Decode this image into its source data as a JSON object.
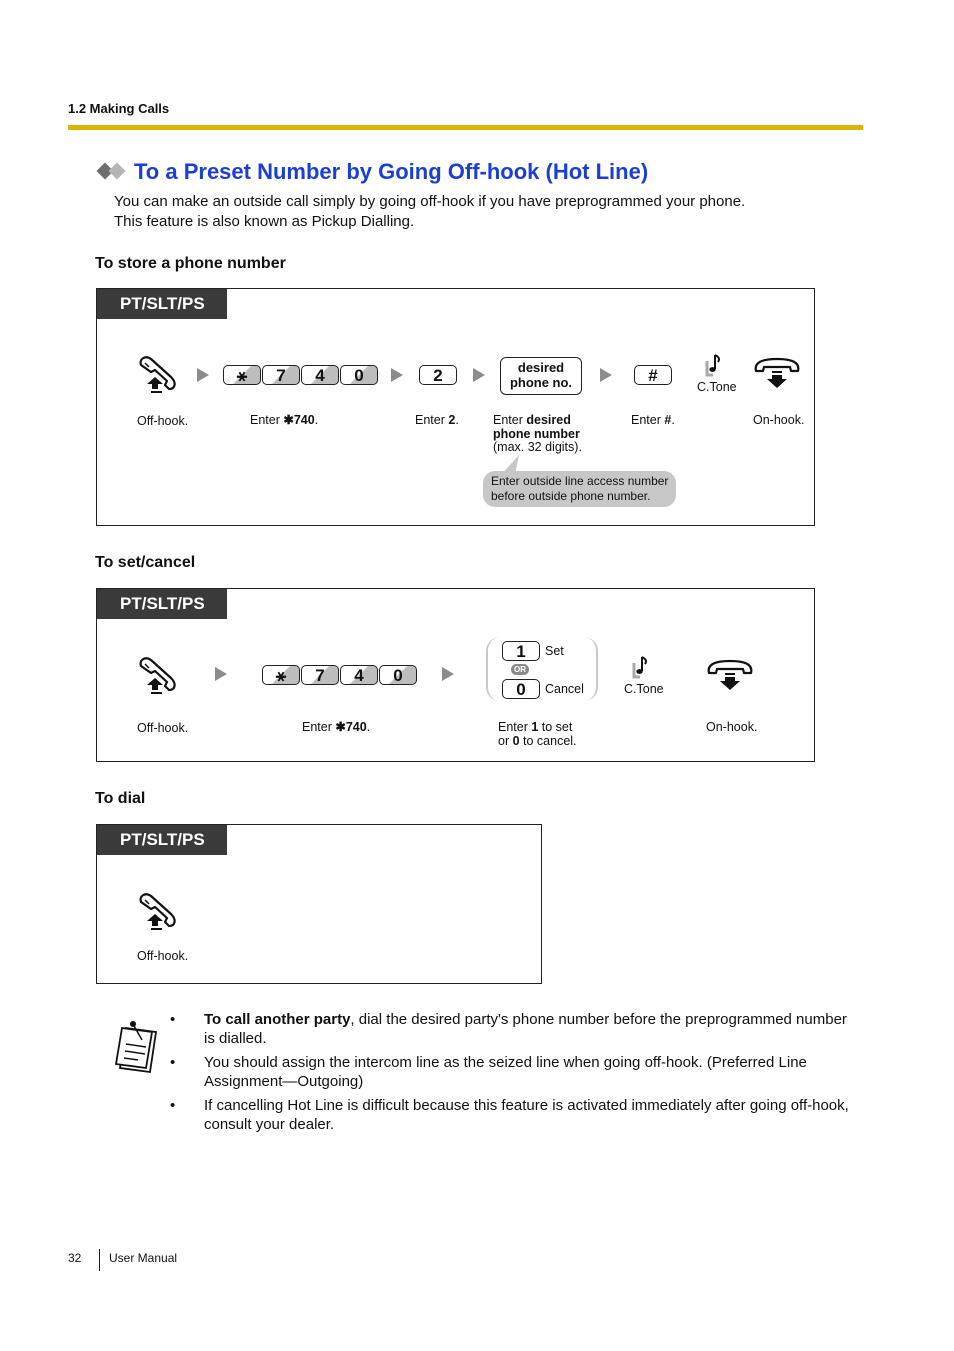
{
  "header": {
    "section": "1.2 Making Calls",
    "accent_color": "#dcb500"
  },
  "title": "To a Preset Number by Going Off-hook (Hot Line)",
  "title_color": "#1b3fd6",
  "intro": [
    "You can make an outside call simply by going off-hook if you have preprogrammed your phone.",
    "This feature is also known as Pickup Dialling."
  ],
  "store": {
    "heading": "To store a phone number",
    "tag": "PT/SLT/PS",
    "keys_feature": [
      "⚹",
      "7",
      "4",
      "0"
    ],
    "key_two": "2",
    "desired_key": [
      "desired",
      "phone no."
    ],
    "hash_key": "#",
    "ctone": "C.Tone",
    "labels": {
      "offhook": "Off-hook.",
      "enter_code_prefix": "Enter ",
      "enter_code_bold": "✱740",
      "enter_code_suffix": ".",
      "enter2_prefix": "Enter ",
      "enter2_bold": "2",
      "enter2_suffix": ".",
      "desired_prefix": "Enter ",
      "desired_bold1": "desired",
      "desired_bold2": "phone number",
      "desired_note": "(max. 32 digits).",
      "hash_prefix": "Enter ",
      "hash_bold": "#",
      "hash_suffix": ".",
      "onhook": "On-hook."
    },
    "bubble": [
      "Enter outside line access number",
      "before outside phone number."
    ]
  },
  "setcancel": {
    "heading": "To set/cancel",
    "tag": "PT/SLT/PS",
    "keys_feature": [
      "⚹",
      "7",
      "4",
      "0"
    ],
    "key_set": "1",
    "set_label": "Set",
    "or_label": "OR",
    "key_cancel": "0",
    "cancel_label": "Cancel",
    "ctone": "C.Tone",
    "labels": {
      "offhook": "Off-hook.",
      "enter_code_prefix": "Enter ",
      "enter_code_bold": "✱740",
      "enter_code_suffix": ".",
      "choice_l1_prefix": "Enter ",
      "choice_l1_bold": "1",
      "choice_l1_suffix": " to set",
      "choice_l2_prefix": "or ",
      "choice_l2_bold": "0",
      "choice_l2_suffix": " to cancel.",
      "onhook": "On-hook."
    }
  },
  "dial": {
    "heading": "To dial",
    "tag": "PT/SLT/PS",
    "labels": {
      "offhook": "Off-hook."
    }
  },
  "notes": [
    {
      "bold": "To call another party",
      "text": ", dial the desired party's phone number before the preprogrammed number is dialled."
    },
    {
      "bold": "",
      "text": "You should assign the intercom line as the seized line when going off-hook. (Preferred Line Assignment—Outgoing)"
    },
    {
      "bold": "",
      "text": "If cancelling Hot Line is difficult because this feature is activated immediately after going off-hook, consult your dealer."
    }
  ],
  "bullet": "•",
  "footer": {
    "page": "32",
    "label": "User Manual"
  }
}
